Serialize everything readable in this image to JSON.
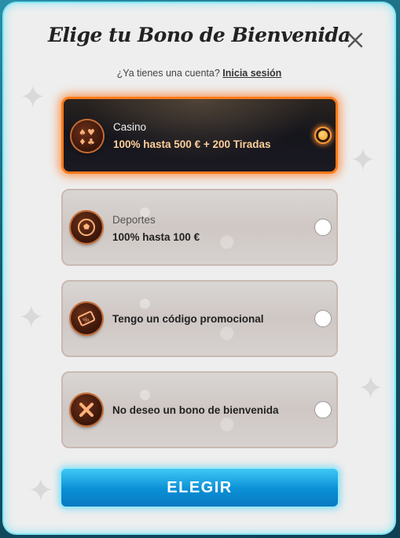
{
  "modal": {
    "title": "Elige tu Bono de Bienvenida",
    "login_prompt": "¿Ya tienes una cuenta?",
    "login_link": "Inicia sesión"
  },
  "options": [
    {
      "title": "Casino",
      "subtitle": "100% hasta 500 € + 200 Tiradas",
      "selected": true,
      "icon": "card-suits-icon"
    },
    {
      "title": "Deportes",
      "subtitle": "100% hasta 100 €",
      "selected": false,
      "icon": "soccer-ball-icon"
    },
    {
      "label": "Tengo un código promocional",
      "selected": false,
      "icon": "promo-ticket-icon"
    },
    {
      "label": "No deseo un bono de bienvenida",
      "selected": false,
      "icon": "x-mark-icon"
    }
  ],
  "button": {
    "label": "ELEGIR"
  },
  "colors": {
    "accent": "#ff7a1a",
    "button": "#0a8fd6",
    "border": "#7fe6f5"
  }
}
